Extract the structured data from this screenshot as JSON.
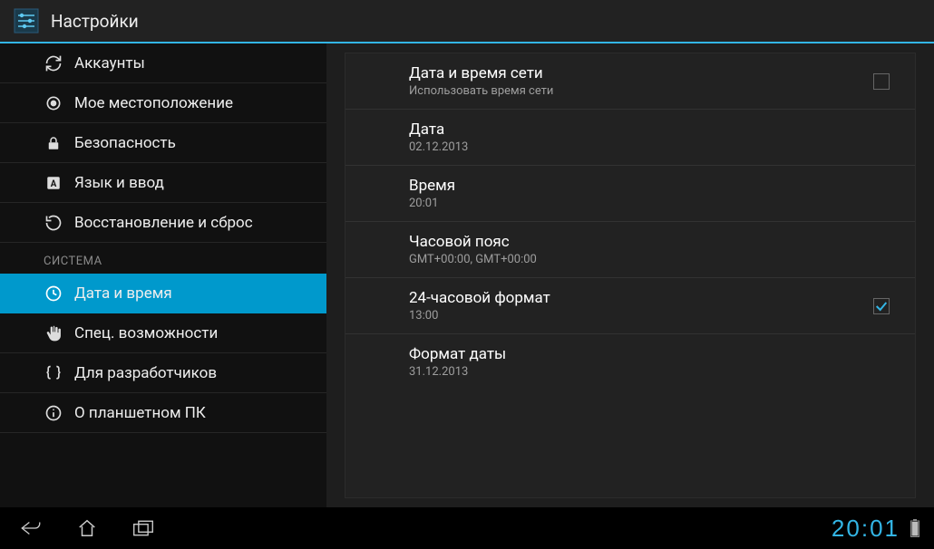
{
  "header": {
    "title": "Настройки"
  },
  "sidebar": {
    "items": [
      {
        "label": "Аккаунты"
      },
      {
        "label": "Мое местоположение"
      },
      {
        "label": "Безопасность"
      },
      {
        "label": "Язык и ввод"
      },
      {
        "label": "Восстановление и сброс"
      }
    ],
    "section_label": "СИСТЕМА",
    "items2": [
      {
        "label": "Дата и время"
      },
      {
        "label": "Спец. возможности"
      },
      {
        "label": "Для разработчиков"
      },
      {
        "label": "О планшетном ПК"
      }
    ]
  },
  "content": {
    "rows": [
      {
        "title": "Дата и время сети",
        "sub": "Использовать время сети",
        "checkbox": true,
        "checked": false
      },
      {
        "title": "Дата",
        "sub": "02.12.2013"
      },
      {
        "title": "Время",
        "sub": "20:01"
      },
      {
        "title": "Часовой пояс",
        "sub": "GMT+00:00, GMT+00:00"
      },
      {
        "title": "24-часовой формат",
        "sub": "13:00",
        "checkbox": true,
        "checked": true
      },
      {
        "title": "Формат даты",
        "sub": "31.12.2013"
      }
    ]
  },
  "navbar": {
    "clock": "20:01"
  }
}
